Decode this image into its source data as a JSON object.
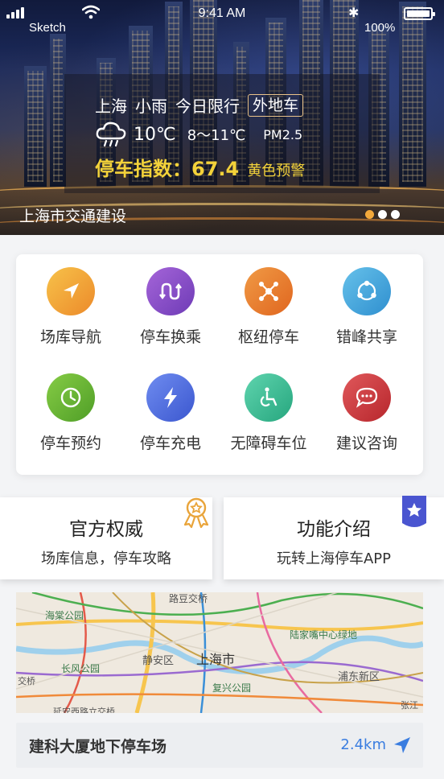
{
  "status_bar": {
    "carrier": "Sketch",
    "time": "9:41 AM",
    "battery": "100%"
  },
  "hero": {
    "city": "上海",
    "weather": "小雨",
    "restriction_label": "今日限行",
    "restriction_tag": "外地车",
    "temperature": "10℃",
    "temp_range": "8～11℃",
    "pm": "PM2.5",
    "parking_index": "停车指数：67.4",
    "warning": "黄色预警",
    "caption": "上海市交通建设",
    "carousel_active_index": 0,
    "carousel_count": 3
  },
  "grid": [
    {
      "label": "场库导航",
      "icon": "navigation-arrow-icon",
      "color": "#f2a33a"
    },
    {
      "label": "停车换乘",
      "icon": "transfer-icon",
      "color": "#8a4fc7"
    },
    {
      "label": "枢纽停车",
      "icon": "hub-icon",
      "color": "#ea7a2a"
    },
    {
      "label": "错峰共享",
      "icon": "share-icon",
      "color": "#45a9dc"
    },
    {
      "label": "停车预约",
      "icon": "clock-icon",
      "color": "#62b634"
    },
    {
      "label": "停车充电",
      "icon": "lightning-icon",
      "color": "#4f6ee0"
    },
    {
      "label": "无障碍车位",
      "icon": "wheelchair-icon",
      "color": "#3cbf9b"
    },
    {
      "label": "建议咨询",
      "icon": "chat-icon",
      "color": "#d0353a"
    }
  ],
  "features": [
    {
      "title": "官方权威",
      "subtitle": "场库信息，停车攻略",
      "icon": "award-ribbon-icon"
    },
    {
      "title": "功能介绍",
      "subtitle": "玩转上海停车APP",
      "icon": "star-badge-icon"
    }
  ],
  "map": {
    "labels": [
      "路豆交桥",
      "海棠公园",
      "上海市",
      "静安区",
      "长风公园",
      "陆家嘴中心绿地",
      "复兴公园",
      "浦东新区",
      "交桥",
      "张江",
      "延安西路立交桥"
    ]
  },
  "destination": {
    "name": "建科大厦地下停车场",
    "distance": "2.4km"
  },
  "colors": {
    "accent": "#3a7de0",
    "index_yellow": "#f3d23a",
    "carousel_active": "#f3a93b"
  }
}
